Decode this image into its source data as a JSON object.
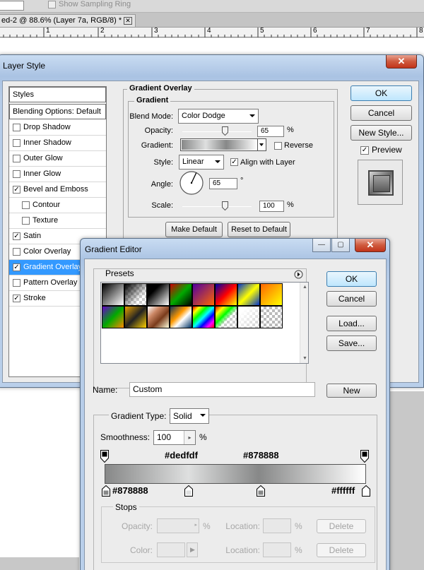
{
  "app": {
    "options_bar": {
      "sample_ring_label": "Show Sampling Ring"
    },
    "doc_tab": {
      "title": "ed-2 @ 88.6% (Layer 7a, RGB/8) *",
      "close_glyph": "✕"
    },
    "ruler_ticks": [
      "1",
      "2",
      "3",
      "4",
      "5",
      "6",
      "7",
      "8"
    ]
  },
  "layer_style": {
    "title": "Layer Style",
    "close_glyph": "✕",
    "styles_list": [
      {
        "label": "Styles",
        "type": "header"
      },
      {
        "label": "Blending Options: Default",
        "type": "header"
      },
      {
        "label": "Drop Shadow",
        "checked": false,
        "indent": 0
      },
      {
        "label": "Inner Shadow",
        "checked": false,
        "indent": 0
      },
      {
        "label": "Outer Glow",
        "checked": false,
        "indent": 0
      },
      {
        "label": "Inner Glow",
        "checked": false,
        "indent": 0
      },
      {
        "label": "Bevel and Emboss",
        "checked": true,
        "indent": 0
      },
      {
        "label": "Contour",
        "checked": false,
        "indent": 1
      },
      {
        "label": "Texture",
        "checked": false,
        "indent": 1
      },
      {
        "label": "Satin",
        "checked": true,
        "indent": 0
      },
      {
        "label": "Color Overlay",
        "checked": false,
        "indent": 0
      },
      {
        "label": "Gradient Overlay",
        "checked": true,
        "indent": 0,
        "selected": true
      },
      {
        "label": "Pattern Overlay",
        "checked": false,
        "indent": 0
      },
      {
        "label": "Stroke",
        "checked": true,
        "indent": 0
      }
    ],
    "section_title": "Gradient Overlay",
    "group_title": "Gradient",
    "blend_mode": {
      "label": "Blend Mode:",
      "value": "Color Dodge"
    },
    "opacity": {
      "label": "Opacity:",
      "value": "65",
      "unit": "%",
      "level": 0.65
    },
    "gradient": {
      "label": "Gradient:",
      "reverse_label": "Reverse",
      "reverse_checked": false
    },
    "style": {
      "label": "Style:",
      "value": "Linear",
      "align_label": "Align with Layer",
      "align_checked": true
    },
    "angle": {
      "label": "Angle:",
      "value": "65",
      "unit": "°"
    },
    "scale": {
      "label": "Scale:",
      "value": "100",
      "unit": "%",
      "level": 0.5
    },
    "make_default": "Make Default",
    "reset_default": "Reset to Default",
    "ok": "OK",
    "cancel": "Cancel",
    "new_style": "New Style...",
    "preview_label": "Preview",
    "preview_checked": true
  },
  "gradient_editor": {
    "title": "Gradient Editor",
    "minimize_glyph": "—",
    "maximize_glyph": "▢",
    "close_glyph": "✕",
    "presets_label": "Presets",
    "ok": "OK",
    "cancel": "Cancel",
    "load": "Load...",
    "save": "Save...",
    "name_label": "Name:",
    "name_value": "Custom",
    "new_button": "New",
    "gradient_type_label": "Gradient Type:",
    "gradient_type_value": "Solid",
    "smoothness_label": "Smoothness:",
    "smoothness_value": "100",
    "smoothness_unit": "%",
    "top_stop_labels": [
      "#dedfdf",
      "#878888"
    ],
    "bottom_stop_labels": [
      "#878888",
      "#ffffff"
    ],
    "color_stops": [
      {
        "pos": 0.0,
        "color": "#878888"
      },
      {
        "pos": 0.32,
        "color": "#dedfdf"
      },
      {
        "pos": 0.59,
        "color": "#878888"
      },
      {
        "pos": 1.0,
        "color": "#ffffff"
      }
    ],
    "stops_title": "Stops",
    "stop_opacity_label": "Opacity:",
    "stop_opacity_unit": "%",
    "location_label": "Location:",
    "location_unit": "%",
    "delete_label": "Delete",
    "stop_color_label": "Color:"
  }
}
